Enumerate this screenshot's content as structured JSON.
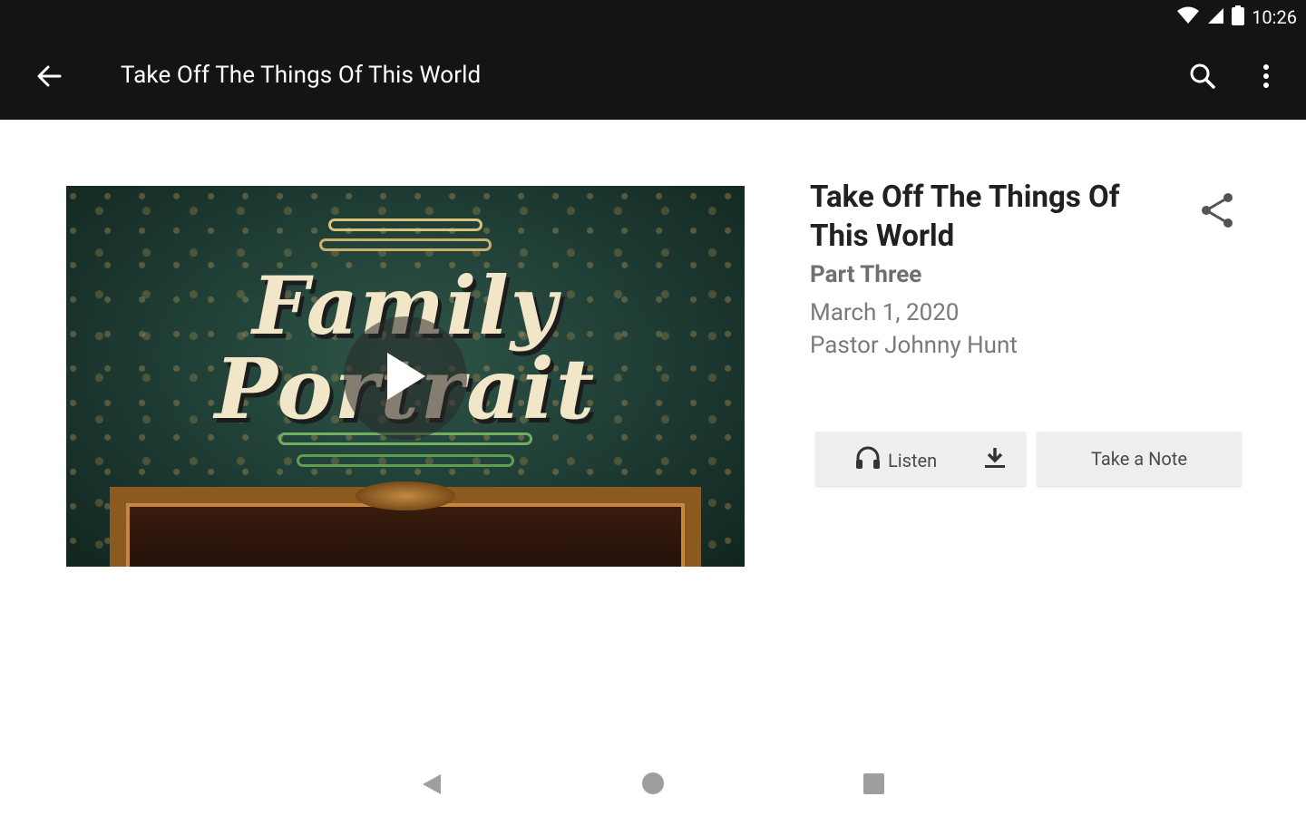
{
  "status_bar": {
    "time": "10:26",
    "icons": [
      "wifi-icon",
      "cell-signal-icon",
      "battery-icon"
    ]
  },
  "app_bar": {
    "title": "Take Off The Things Of This World",
    "icons": [
      "back-arrow-icon",
      "search-icon",
      "more-vert-icon"
    ]
  },
  "media": {
    "artwork_title_line1": "Family",
    "artwork_title_line2": "Portrait",
    "overlay_icon": "play-icon"
  },
  "details": {
    "title": "Take Off The Things Of This World",
    "series_part": "Part Three",
    "date": "March 1, 2020",
    "speaker": "Pastor Johnny Hunt",
    "share_icon": "share-icon"
  },
  "actions": {
    "listen_label": "Listen",
    "listen_icon": "headphones-icon",
    "download_icon": "download-icon",
    "note_label": "Take a Note"
  },
  "nav_bar": {
    "icons": [
      "nav-back-icon",
      "nav-home-icon",
      "nav-recents-icon"
    ]
  },
  "colors": {
    "app_bar_bg": "#141414",
    "button_bg": "#eeeeee",
    "title_text": "#212121",
    "secondary_text": "#7a7a7a"
  }
}
